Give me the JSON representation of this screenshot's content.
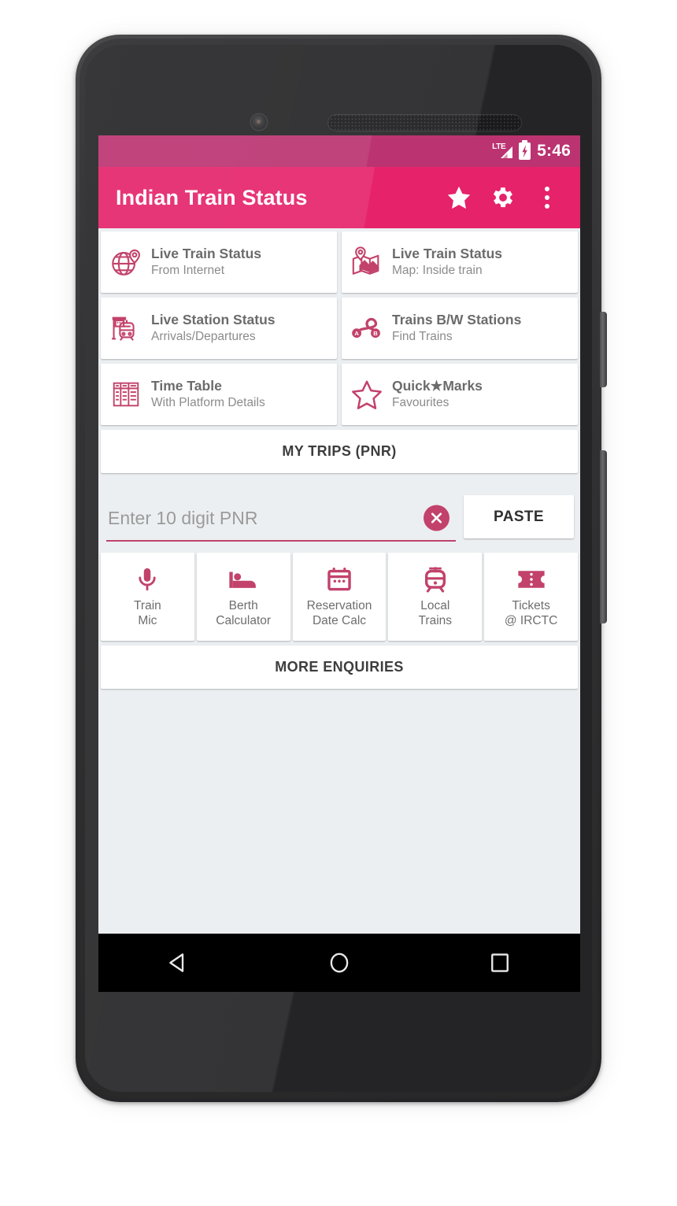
{
  "status_bar": {
    "network_label": "LTE",
    "time": "5:46",
    "battery_icon": "battery-charging-icon",
    "signal_icon": "signal-bars-icon"
  },
  "app_bar": {
    "title": "Indian Train Status",
    "actions": [
      {
        "name": "favourites-star-button",
        "icon": "star-icon"
      },
      {
        "name": "settings-button",
        "icon": "gear-icon"
      },
      {
        "name": "overflow-menu-button",
        "icon": "more-vertical-icon"
      }
    ]
  },
  "tiles": [
    {
      "title": "Live Train Status",
      "subtitle": "From Internet",
      "icon": "globe-pin-icon",
      "name": "tile-live-train-status-internet"
    },
    {
      "title": "Live Train Status",
      "subtitle": "Map: Inside train",
      "icon": "map-pin-icon",
      "name": "tile-live-train-status-map"
    },
    {
      "title": "Live Station Status",
      "subtitle": "Arrivals/Departures",
      "icon": "station-train-icon",
      "name": "tile-live-station-status"
    },
    {
      "title": "Trains B/W Stations",
      "subtitle": "Find Trains",
      "icon": "route-ab-icon",
      "name": "tile-trains-between-stations"
    },
    {
      "title": "Time Table",
      "subtitle": "With Platform Details",
      "icon": "timetable-grid-icon",
      "name": "tile-time-table"
    },
    {
      "title": "Quick★Marks",
      "subtitle": "Favourites",
      "icon": "star-outline-icon",
      "name": "tile-quick-marks"
    }
  ],
  "my_trips_button": {
    "label": "MY TRIPS (PNR)"
  },
  "pnr": {
    "placeholder": "Enter 10 digit PNR",
    "value": "",
    "clear_icon": "clear-circle-icon",
    "paste_label": "PASTE"
  },
  "quick_actions": [
    {
      "line1": "Train",
      "line2": "Mic",
      "icon": "microphone-icon",
      "name": "quick-action-train-mic"
    },
    {
      "line1": "Berth",
      "line2": "Calculator",
      "icon": "bed-icon",
      "name": "quick-action-berth-calculator"
    },
    {
      "line1": "Reservation",
      "line2": "Date Calc",
      "icon": "calendar-icon",
      "name": "quick-action-reservation-date-calc"
    },
    {
      "line1": "Local",
      "line2": "Trains",
      "icon": "tram-icon",
      "name": "quick-action-local-trains"
    },
    {
      "line1": "Tickets",
      "line2": "@ IRCTC",
      "icon": "ticket-icon",
      "name": "quick-action-tickets-irctc"
    }
  ],
  "more_enquiries_button": {
    "label": "MORE ENQUIRIES"
  },
  "nav_bar": [
    {
      "name": "nav-back-button",
      "icon": "triangle-back-icon"
    },
    {
      "name": "nav-home-button",
      "icon": "circle-home-icon"
    },
    {
      "name": "nav-recents-button",
      "icon": "square-recents-icon"
    }
  ],
  "colors": {
    "status_bar": "#bb3371",
    "app_bar": "#e5226a",
    "accent": "#c2426b",
    "screen_background": "#eceff1",
    "card": "#ffffff",
    "title_text": "#6b6b6b",
    "subtitle_text": "#8b8b8b"
  }
}
